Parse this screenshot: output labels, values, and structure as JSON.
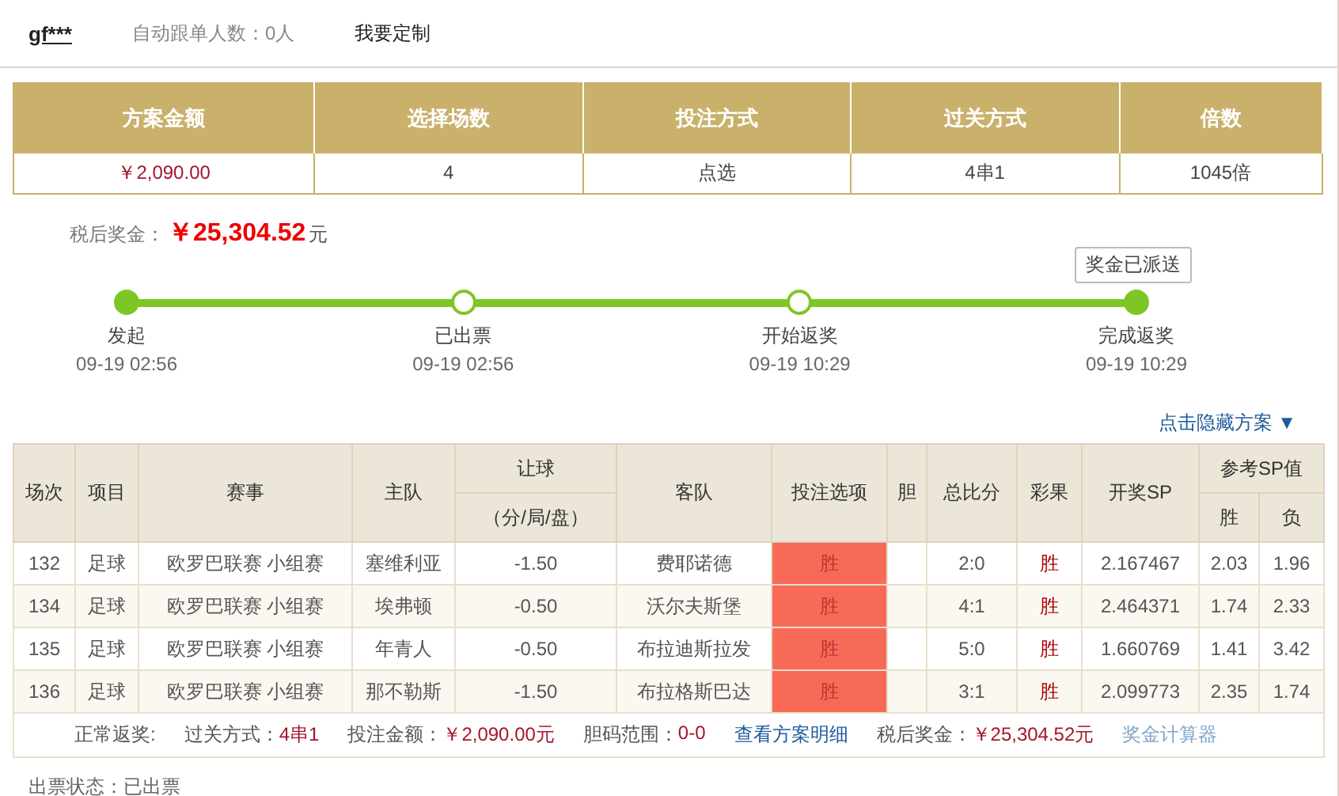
{
  "user": {
    "name": "gf***",
    "followers": "自动跟单人数：0人",
    "customize_link": "我要定制"
  },
  "summary": {
    "columns": [
      "方案金额",
      "选择场数",
      "投注方式",
      "过关方式",
      "倍数"
    ],
    "values": [
      {
        "text": "￥2,090.00",
        "kind": "money"
      },
      {
        "text": "4",
        "kind": "plain"
      },
      {
        "text": "点选",
        "kind": "plain"
      },
      {
        "text": "4串1",
        "kind": "plain"
      },
      {
        "text": "1045倍",
        "kind": "plain"
      }
    ]
  },
  "prize": {
    "label": "税后奖金：",
    "amount": "￥25,304.52",
    "unit": "元"
  },
  "status_badge": "奖金已派送",
  "timeline": [
    {
      "label": "发起",
      "time": "09-19 02:56",
      "done": true
    },
    {
      "label": "已出票",
      "time": "09-19 02:56",
      "done": false
    },
    {
      "label": "开始返奖",
      "time": "09-19 10:29",
      "done": false
    },
    {
      "label": "完成返奖",
      "time": "09-19 10:29",
      "done": true
    }
  ],
  "toggle_link": "点击隐藏方案 ▼",
  "table": {
    "columns": [
      {
        "label": "场次"
      },
      {
        "label": "项目"
      },
      {
        "label": "赛事"
      },
      {
        "label": "主队"
      },
      {
        "label": "让球",
        "children": [
          {
            "label": "（分/局/盘）"
          }
        ]
      },
      {
        "label": "客队"
      },
      {
        "label": "投注选项"
      },
      {
        "label": "胆"
      },
      {
        "label": "总比分"
      },
      {
        "label": "彩果"
      },
      {
        "label": "开奖SP"
      },
      {
        "label": "参考SP值",
        "children": [
          {
            "label": "胜"
          },
          {
            "label": "负"
          }
        ]
      }
    ],
    "rows": [
      {
        "no": "132",
        "sport": "足球",
        "league": "欧罗巴联赛 小组赛",
        "home": "塞维利亚",
        "handicap": "-1.50",
        "away": "费耶诺德",
        "pick": "胜",
        "score": "2:0",
        "result": "胜",
        "sp": "2.167467",
        "ref_win": "2.03",
        "ref_lose": "1.96"
      },
      {
        "no": "134",
        "sport": "足球",
        "league": "欧罗巴联赛 小组赛",
        "home": "埃弗顿",
        "handicap": "-0.50",
        "away": "沃尔夫斯堡",
        "pick": "胜",
        "score": "4:1",
        "result": "胜",
        "sp": "2.464371",
        "ref_win": "1.74",
        "ref_lose": "2.33"
      },
      {
        "no": "135",
        "sport": "足球",
        "league": "欧罗巴联赛 小组赛",
        "home": "年青人",
        "handicap": "-0.50",
        "away": "布拉迪斯拉发",
        "pick": "胜",
        "score": "5:0",
        "result": "胜",
        "sp": "1.660769",
        "ref_win": "1.41",
        "ref_lose": "3.42"
      },
      {
        "no": "136",
        "sport": "足球",
        "league": "欧罗巴联赛 小组赛",
        "home": "那不勒斯",
        "handicap": "-1.50",
        "away": "布拉格斯巴达",
        "pick": "胜",
        "score": "3:1",
        "result": "胜",
        "sp": "2.099773",
        "ref_win": "2.35",
        "ref_lose": "1.74"
      }
    ],
    "footer": {
      "label": "正常返奖:",
      "items": [
        {
          "kind": "field",
          "label": "过关方式：",
          "value": "4串1"
        },
        {
          "kind": "field",
          "label": "投注金额：",
          "value": "￥2,090.00元"
        },
        {
          "kind": "field",
          "label": "胆码范围：",
          "value": "0-0"
        },
        {
          "kind": "link",
          "text": "查看方案明细"
        },
        {
          "kind": "field",
          "label": "税后奖金：",
          "value": "￥25,304.52元"
        },
        {
          "kind": "link",
          "text": "奖金计算器"
        }
      ]
    }
  },
  "ticket_status": "出票状态：已出票"
}
